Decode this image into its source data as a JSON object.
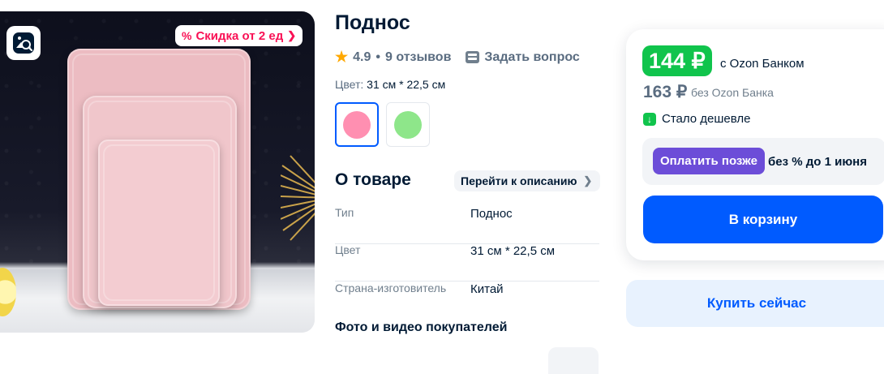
{
  "product": {
    "title": "Поднос",
    "rating": "4.9",
    "reviews": "9 отзывов",
    "ask_question": "Задать вопрос",
    "color_label": "Цвет:",
    "color_value": "31 см * 22,5 см",
    "swatches": [
      {
        "color": "#ff8fb1",
        "selected": true
      },
      {
        "color": "#8ee68a",
        "selected": false
      }
    ]
  },
  "image": {
    "discount_badge": "Скидка от 2 ед",
    "search_icon": "image-search-icon"
  },
  "about": {
    "heading": "О товаре",
    "go_to_description": "Перейти к описанию",
    "specs": [
      {
        "key": "Тип",
        "value": "Поднос"
      },
      {
        "key": "Цвет",
        "value": "31 см * 22,5 см"
      },
      {
        "key": "Страна-изготовитель",
        "value": "Китай"
      }
    ],
    "photos_heading": "Фото и видео покупателей"
  },
  "buy": {
    "price_bank": "144 ₽",
    "price_bank_note": "с Ozon Банком",
    "price_regular": "163 ₽",
    "price_regular_note": "без Ozon Банка",
    "cheaper": "Стало дешевле",
    "pay_later": "Оплатить позже",
    "pay_later_note": "без % до 1 июня",
    "add_to_cart": "В корзину",
    "buy_now": "Купить сейчас"
  },
  "colors": {
    "accent": "#005bff",
    "price_green": "#10c44c",
    "pay_later_purple": "#6c4dd8",
    "discount_pink": "#f91155"
  }
}
